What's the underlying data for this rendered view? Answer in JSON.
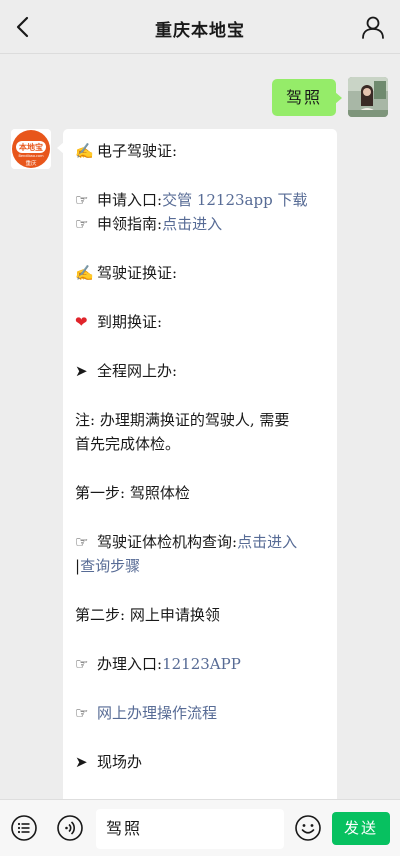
{
  "header": {
    "title": "重庆本地宝",
    "back_icon": "chevron-left-icon",
    "profile_icon": "person-icon"
  },
  "my_message": {
    "text": "驾照",
    "bubble_color": "#95ec69"
  },
  "bot_avatar": {
    "brand_text": "本地宝",
    "sub_text": "Bendibao.com",
    "city": "重庆",
    "color": "#e8561b"
  },
  "message": {
    "section1_title": "电子驾驶证:",
    "apply_prefix": "申请入口:",
    "apply_link": "交管 12123app 下载",
    "guide_prefix": "申领指南:",
    "guide_link": "点击进入",
    "section2_title": "驾驶证换证:",
    "expire_title": "到期换证:",
    "online_title": "全程网上办:",
    "note_line1": "注: 办理期满换证的驾驶人, 需要",
    "note_line2": "首先完成体检。",
    "step1": "第一步: 驾照体检",
    "inst_prefix": "驾驶证体检机构查询:",
    "inst_link": "点击进入",
    "inst_sep": "|",
    "inst_link2": "查询步骤",
    "step2": "第二步: 网上申请换领",
    "handle_prefix": "办理入口:",
    "handle_link": "12123APP",
    "process_link": "网上办理操作流程",
    "onsite_title": "现场办",
    "link_color": "#576b95"
  },
  "input": {
    "text": "驾照"
  },
  "bottombar": {
    "send_label": "发送",
    "send_color": "#07c160",
    "menu_icon": "menu-icon",
    "voice_icon": "voice-icon",
    "emoji_icon": "emoji-icon"
  }
}
